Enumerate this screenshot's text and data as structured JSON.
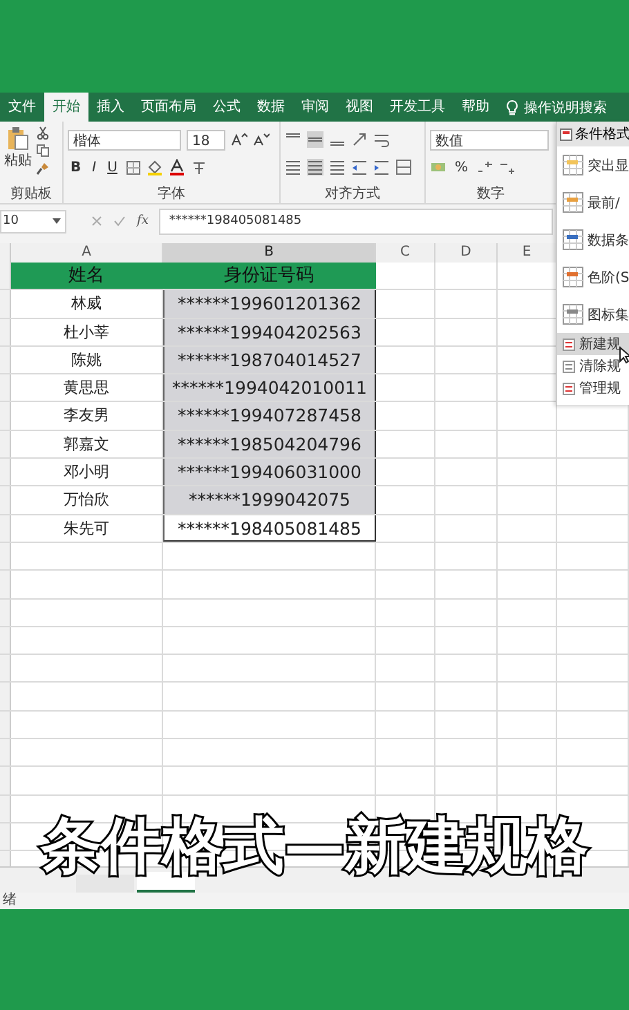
{
  "ribbon_tabs": [
    {
      "label": "文件",
      "selected": false
    },
    {
      "label": "开始",
      "selected": true
    },
    {
      "label": "插入",
      "selected": false
    },
    {
      "label": "页面布局",
      "selected": false
    },
    {
      "label": "公式",
      "selected": false
    },
    {
      "label": "数据",
      "selected": false
    },
    {
      "label": "审阅",
      "selected": false
    },
    {
      "label": "视图",
      "selected": false
    },
    {
      "label": "开发工具",
      "selected": false
    },
    {
      "label": "帮助",
      "selected": false
    }
  ],
  "search": {
    "label": "操作说明搜索"
  },
  "clipboard": {
    "paste": "粘贴",
    "label": "剪贴板"
  },
  "font": {
    "name": "楷体",
    "size": "18",
    "bold": "B",
    "italic": "I",
    "underline": "U",
    "label": "字体"
  },
  "alignment": {
    "label": "对齐方式"
  },
  "number": {
    "format": "数值",
    "percent": "%",
    "label": "数字"
  },
  "formula_bar": {
    "name_box": "10",
    "fx": "fx",
    "value": "******198405081485"
  },
  "columns": [
    {
      "label": "A",
      "selected": false
    },
    {
      "label": "B",
      "selected": true
    },
    {
      "label": "C",
      "selected": false
    },
    {
      "label": "D",
      "selected": false
    },
    {
      "label": "E",
      "selected": false
    }
  ],
  "table": {
    "header": [
      "姓名",
      "身份证号码"
    ],
    "rows": [
      {
        "name": "林威",
        "id": "******199601201362",
        "selected": true
      },
      {
        "name": "杜小莘",
        "id": "******199404202563",
        "selected": true
      },
      {
        "name": "陈姚",
        "id": "******198704014527",
        "selected": true
      },
      {
        "name": "黄思思",
        "id": "******1994042010011",
        "selected": true
      },
      {
        "name": "李友男",
        "id": "******199407287458",
        "selected": true
      },
      {
        "name": "郭嘉文",
        "id": "******198504204796",
        "selected": true
      },
      {
        "name": "邓小明",
        "id": "******199406031000",
        "selected": true
      },
      {
        "name": "万怡欣",
        "id": "******1999042075",
        "selected": true
      },
      {
        "name": "朱先可",
        "id": "******198405081485",
        "selected": false
      }
    ]
  },
  "conditional_format_menu": {
    "button": "条件格式",
    "items": [
      {
        "label": "突出显",
        "kind": "large",
        "selected": false
      },
      {
        "label": "最前/",
        "kind": "large",
        "selected": false
      },
      {
        "label": "数据条",
        "kind": "large",
        "selected": false
      },
      {
        "label": "色阶(S",
        "kind": "large",
        "selected": false
      },
      {
        "label": "图标集",
        "kind": "large",
        "selected": false
      },
      {
        "label": "新建规",
        "kind": "small",
        "selected": true
      },
      {
        "label": "清除规",
        "kind": "small",
        "selected": false
      },
      {
        "label": "管理规",
        "kind": "small",
        "selected": false
      }
    ]
  },
  "status_bar": {
    "text": "绪"
  },
  "caption": "条件格式—新建规格"
}
